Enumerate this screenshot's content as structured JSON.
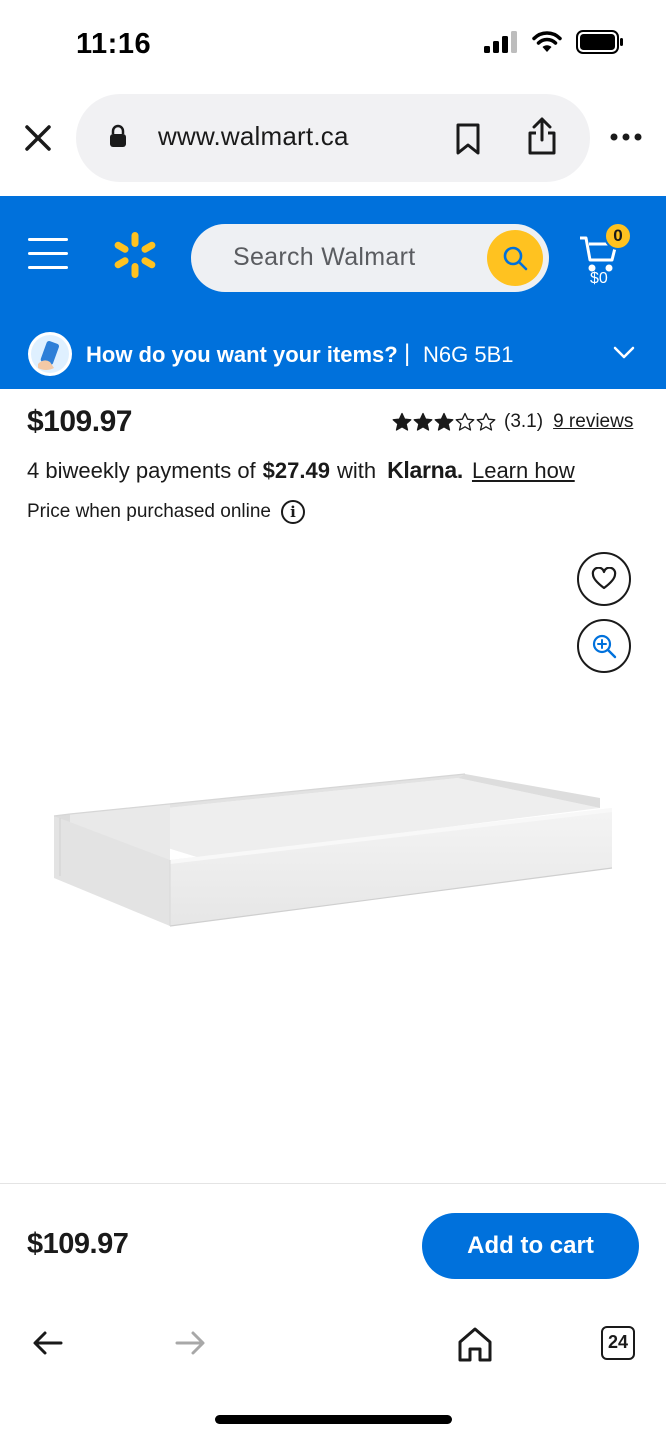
{
  "status_bar": {
    "time": "11:16",
    "icons": [
      "signal-icon",
      "wifi-icon",
      "battery-icon"
    ]
  },
  "browser": {
    "url": "www.walmart.ca",
    "icons": [
      "close-icon",
      "lock-icon",
      "bookmark-icon",
      "share-icon",
      "more-icon"
    ]
  },
  "header": {
    "search_placeholder": "Search Walmart",
    "cart_count": "0",
    "cart_total": "$0",
    "brand_color": "#0071dc",
    "accent_color": "#ffc220"
  },
  "delivery": {
    "question": "How do you want your items?",
    "separator": "|",
    "postal_code": "N6G 5B1"
  },
  "product": {
    "price": "$109.97",
    "rating": 3,
    "rating_max": 5,
    "rating_text": "(3.1)",
    "reviews_text": "9 reviews",
    "payment_prefix": "4 biweekly payments of",
    "payment_amount": "$27.49",
    "payment_with": "with",
    "klarna": "Klarna.",
    "learn_how": "Learn how",
    "online_note": "Price when purchased online",
    "info_glyph": "i"
  },
  "sticky": {
    "price": "$109.97",
    "add_to_cart": "Add to cart"
  },
  "browser_nav": {
    "tab_count": "24"
  }
}
